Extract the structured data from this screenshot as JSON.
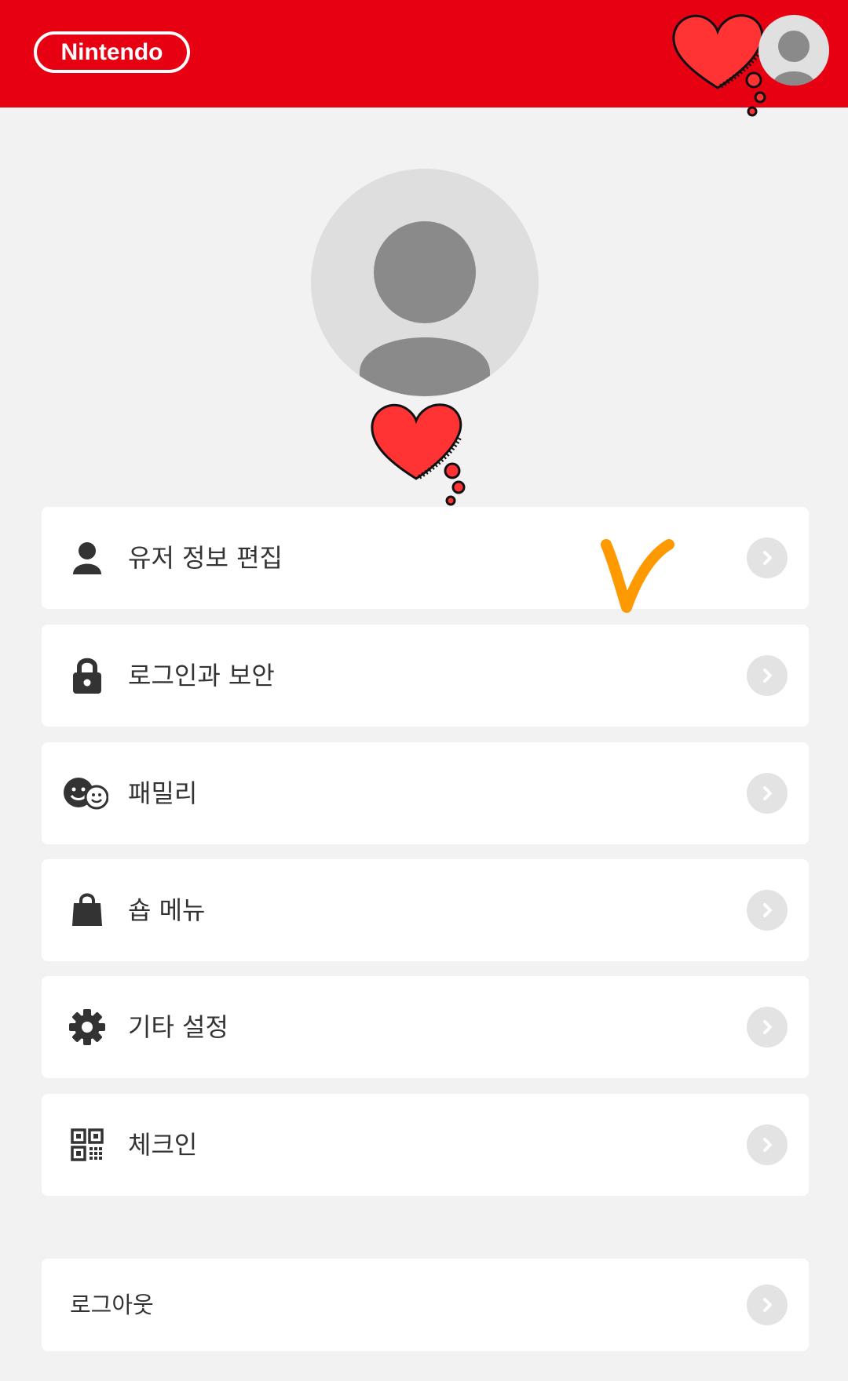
{
  "header": {
    "logo_text": "Nintendo",
    "brand_color": "#e60012",
    "avatar_icon": "user-avatar-icon"
  },
  "profile": {
    "avatar_icon": "user-avatar-icon"
  },
  "menu": {
    "items": [
      {
        "label": "유저 정보 편집",
        "icon": "person-icon"
      },
      {
        "label": "로그인과 보안",
        "icon": "lock-icon"
      },
      {
        "label": "패밀리",
        "icon": "family-icon"
      },
      {
        "label": "숍 메뉴",
        "icon": "shopping-bag-icon"
      },
      {
        "label": "기타 설정",
        "icon": "gear-icon"
      },
      {
        "label": "체크인",
        "icon": "qr-code-icon"
      }
    ],
    "logout_label": "로그아웃"
  },
  "annotations": {
    "heart_color": "#ff3333",
    "check_color": "#ff9900"
  }
}
